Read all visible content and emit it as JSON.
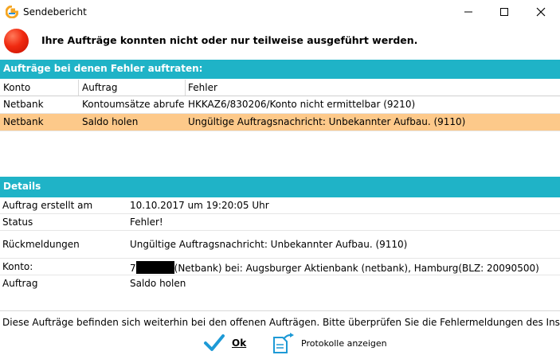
{
  "window": {
    "title": "Sendebericht",
    "brand_color": "#f5a623",
    "accent_color": "#1fb3c7",
    "selection_color": "#fdc98a",
    "error_color": "#f02a10"
  },
  "header": {
    "message": "Ihre Aufträge konnten nicht oder nur teilweise ausgeführt werden."
  },
  "errors": {
    "section_title": "Aufträge bei denen Fehler auftraten:",
    "columns": [
      "Konto",
      "Auftrag",
      "Fehler"
    ],
    "rows": [
      {
        "konto": "Netbank",
        "auftrag": "Kontoumsätze abrufe...",
        "fehler": "HKKAZ6/830206/Konto nicht ermittelbar (9210)",
        "selected": false
      },
      {
        "konto": "Netbank",
        "auftrag": "Saldo holen",
        "fehler": "Ungültige Auftragsnachricht: Unbekannter Aufbau. (9110)",
        "selected": true
      }
    ]
  },
  "details": {
    "section_title": "Details",
    "created_label": "Auftrag erstellt am",
    "created_value": "10.10.2017 um 19:20:05 Uhr",
    "status_label": "Status",
    "status_value": "Fehler!",
    "feedback_label": "Rückmeldungen",
    "feedback_value": "Ungültige Auftragsnachricht: Unbekannter Aufbau. (9110)",
    "account_label": "Konto:",
    "account_prefix": "7",
    "account_value": "(Netbank) bei: Augsburger Aktienbank (netbank), Hamburg(BLZ: 20090500)",
    "order_label": "Auftrag",
    "order_value": "Saldo holen"
  },
  "footer": {
    "hint": "Diese Aufträge befinden sich weiterhin bei den offenen Aufträgen. Bitte überprüfen Sie die Fehlermeldungen des Instituts.",
    "ok_label": "Ok",
    "protocols_label": "Protokolle anzeigen"
  },
  "icons": [
    "app-logo-icon",
    "minimize-icon",
    "maximize-icon",
    "close-icon",
    "error-icon",
    "checkmark-icon",
    "document-export-icon"
  ]
}
